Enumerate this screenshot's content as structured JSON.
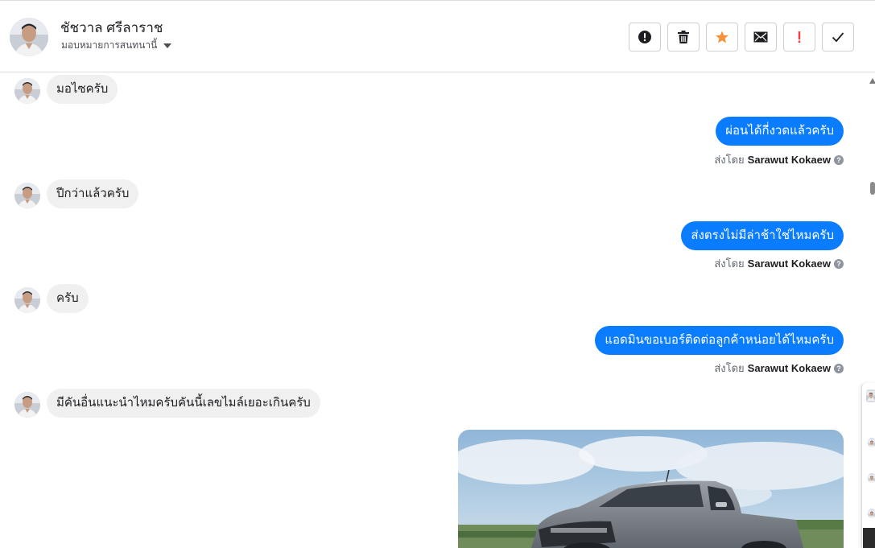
{
  "contact": {
    "name": "ชัชวาล ศรีลาราช",
    "assign_label": "มอบหมายการสนทนานี้"
  },
  "toolbar": [
    {
      "name": "report-button",
      "icon": "exclamation-circle-icon",
      "color": "#1c1e21"
    },
    {
      "name": "delete-button",
      "icon": "trash-icon",
      "color": "#1c1e21"
    },
    {
      "name": "star-button",
      "icon": "star-icon",
      "color": "#f7923a"
    },
    {
      "name": "mark-unread-button",
      "icon": "envelope-icon",
      "color": "#1c1e21"
    },
    {
      "name": "follow-up-button",
      "icon": "exclamation-icon",
      "color": "#fa383e"
    },
    {
      "name": "mark-done-button",
      "icon": "check-icon",
      "color": "#1c1e21"
    }
  ],
  "messages": [
    {
      "direction": "in",
      "text": "มอไซครับ"
    },
    {
      "direction": "out",
      "text": "ผ่อนได้กี่งวดแล้วครับ",
      "sent_by_label": "ส่งโดย",
      "agent": "Sarawut Kokaew"
    },
    {
      "direction": "in",
      "text": "ปีกว่าแล้วครับ"
    },
    {
      "direction": "out",
      "text": "ส่งตรงไม่มีล่าช้าใช่ไหมครับ",
      "sent_by_label": "ส่งโดย",
      "agent": "Sarawut Kokaew"
    },
    {
      "direction": "in",
      "text": "ครับ"
    },
    {
      "direction": "out",
      "text": "แอดมินขอเบอร์ติดต่อลูกค้าหน่อยได้ไหมครับ",
      "sent_by_label": "ส่งโดย",
      "agent": "Sarawut Kokaew"
    },
    {
      "direction": "in",
      "text": "มีคันอื่นแนะนำไหมครับคันนี้เลขไมล์เยอะเกินครับ"
    }
  ],
  "colors": {
    "outgoing_bubble": "#0a7cff",
    "incoming_bubble": "#f0f0f0",
    "star": "#f7923a",
    "flag": "#fa383e"
  }
}
